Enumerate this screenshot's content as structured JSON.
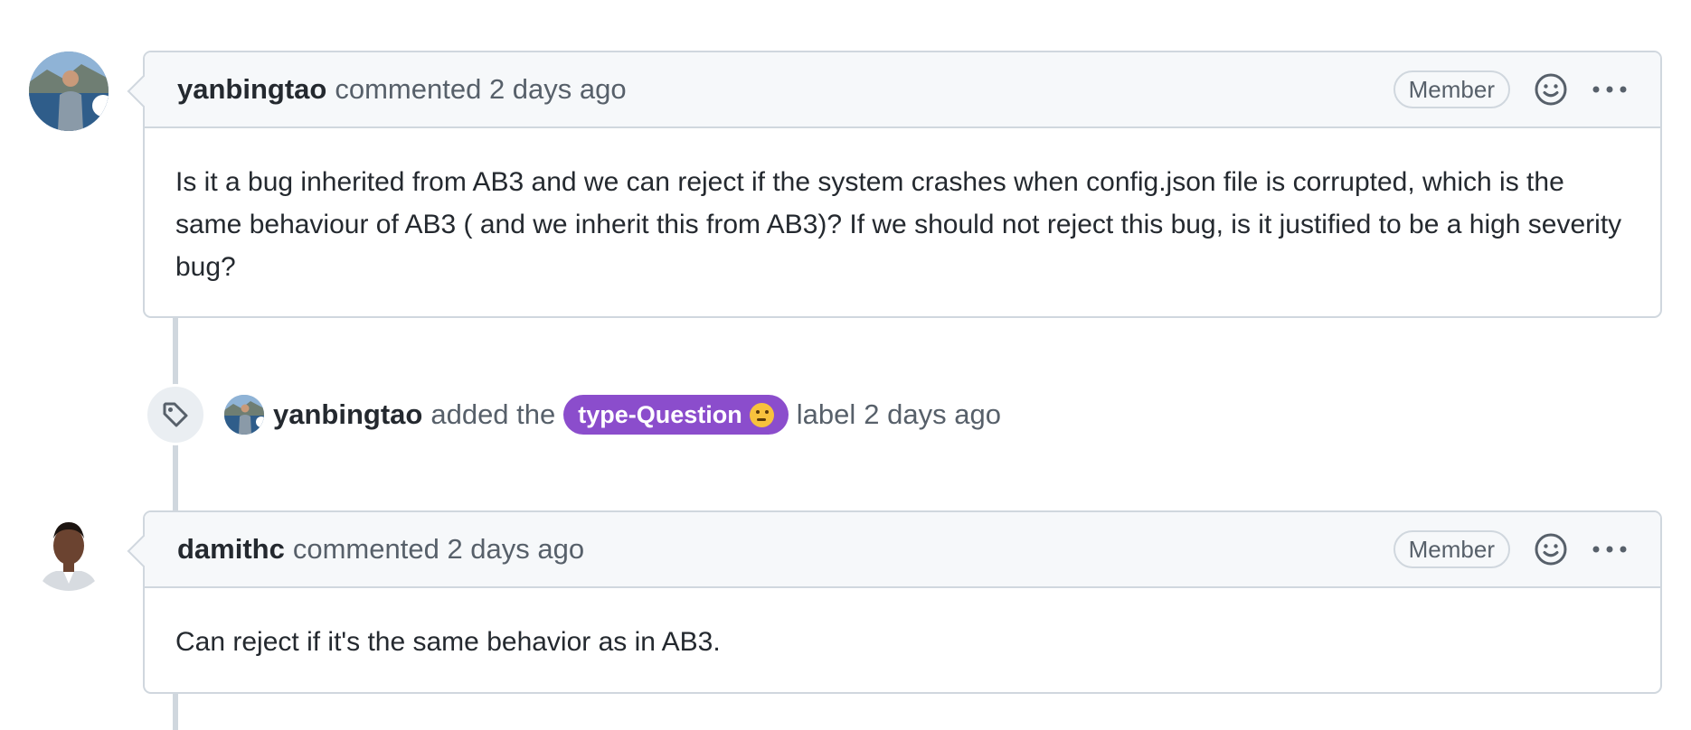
{
  "comments": [
    {
      "author": "yanbingtao",
      "action": "commented",
      "time": "2 days ago",
      "badge": "Member",
      "body": "Is it a bug inherited from AB3 and we can reject if the system crashes when config.json file is corrupted, which is the same behaviour of AB3 ( and we inherit this from AB3)? If we should not reject this bug, is it justified to be a high severity bug?"
    },
    {
      "author": "damithc",
      "action": "commented",
      "time": "2 days ago",
      "badge": "Member",
      "body": "Can reject if it's the same behavior as in AB3."
    }
  ],
  "event": {
    "actor": "yanbingtao",
    "action": "added the",
    "label": "type-Question",
    "label_emoji": "thinking-face",
    "suffix": "label",
    "time": "2 days ago",
    "label_color": "#8b4dcc"
  },
  "icons": {
    "reaction": "smiley-icon",
    "more": "kebab-horizontal-icon",
    "event": "tag-icon"
  },
  "colors": {
    "border": "#d0d7de",
    "header_bg": "#f6f8fa",
    "muted_text": "#57606a",
    "text": "#24292f"
  }
}
